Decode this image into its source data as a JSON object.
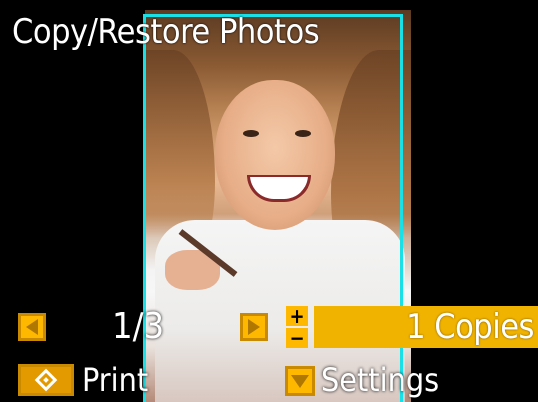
{
  "header": {
    "title": "Copy/Restore Photos"
  },
  "navigation": {
    "counter": "1/3"
  },
  "copies": {
    "label": "1 Copies",
    "plus": "+",
    "minus": "−"
  },
  "actions": {
    "print_label": "Print",
    "settings_label": "Settings"
  },
  "icons": {
    "prev": "left-arrow-icon",
    "next": "right-arrow-icon",
    "print": "start-diamond-icon",
    "settings": "down-arrow-icon"
  },
  "colors": {
    "accent": "#f0b300",
    "crop_frame": "#18e0e6",
    "background": "#000000"
  }
}
